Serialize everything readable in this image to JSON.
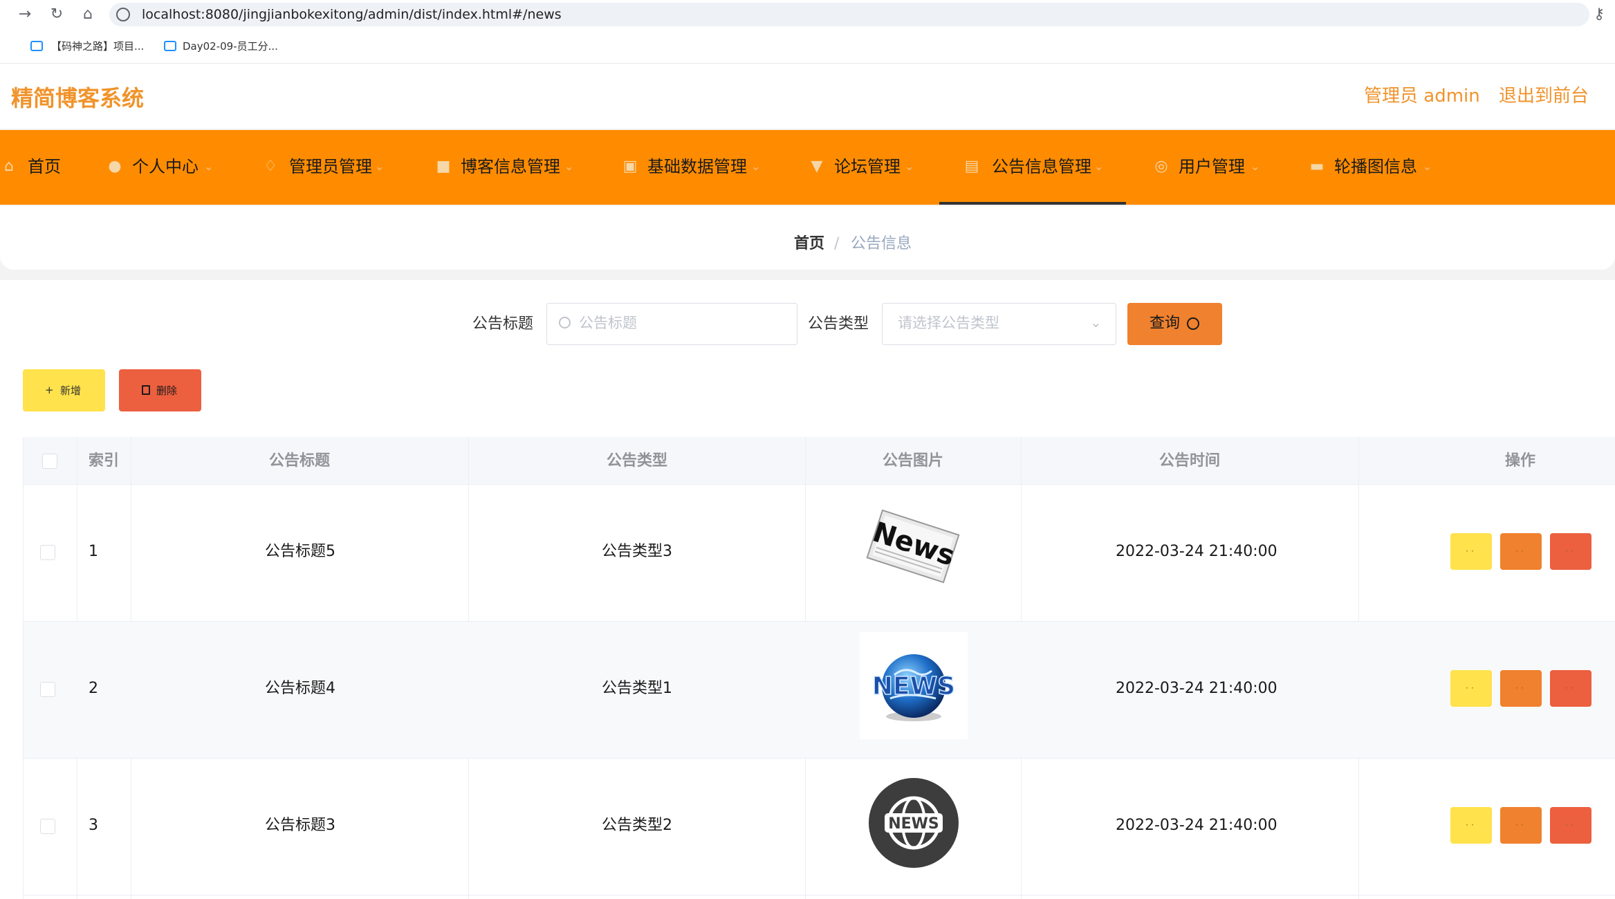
{
  "browser": {
    "url": "localhost:8080/jingjianbokexitong/admin/dist/index.html#/news",
    "bookmarks": [
      {
        "label": "【码神之路】项目..."
      },
      {
        "label": "Day02-09-员工分..."
      }
    ]
  },
  "header": {
    "title": "精简博客系统",
    "admin_label": "管理员 admin",
    "exit_label": "退出到前台"
  },
  "nav": {
    "items": [
      {
        "label": "首页"
      },
      {
        "label": "个人中心"
      },
      {
        "label": "管理员管理"
      },
      {
        "label": "博客信息管理"
      },
      {
        "label": "基础数据管理"
      },
      {
        "label": "论坛管理"
      },
      {
        "label": "公告信息管理"
      },
      {
        "label": "用户管理"
      },
      {
        "label": "轮播图信息"
      }
    ],
    "active_index": 6
  },
  "breadcrumb": {
    "home": "首页",
    "separator": "/",
    "current": "公告信息"
  },
  "search": {
    "title_label": "公告标题",
    "title_placeholder": "公告标题",
    "type_label": "公告类型",
    "type_placeholder": "请选择公告类型",
    "query_label": "查询"
  },
  "toolbar": {
    "add_label": "新增",
    "delete_label": "删除"
  },
  "table": {
    "columns": [
      "索引",
      "公告标题",
      "公告类型",
      "公告图片",
      "公告时间",
      "操作"
    ],
    "rows": [
      {
        "index": "1",
        "title": "公告标题5",
        "type": "公告类型3",
        "image": "news-paper-image",
        "time": "2022-03-24 21:40:00"
      },
      {
        "index": "2",
        "title": "公告标题4",
        "type": "公告类型1",
        "image": "news-globe-image",
        "time": "2022-03-24 21:40:00"
      },
      {
        "index": "3",
        "title": "公告标题3",
        "type": "公告类型2",
        "image": "news-circle-image",
        "time": "2022-03-24 21:40:00"
      }
    ]
  },
  "colors": {
    "nav_bg": "#ff8c00",
    "title_orange": "#f0932b",
    "query_orange": "#f0812e",
    "add_yellow": "#ffe24c",
    "delete_red": "#ec5f3f"
  }
}
